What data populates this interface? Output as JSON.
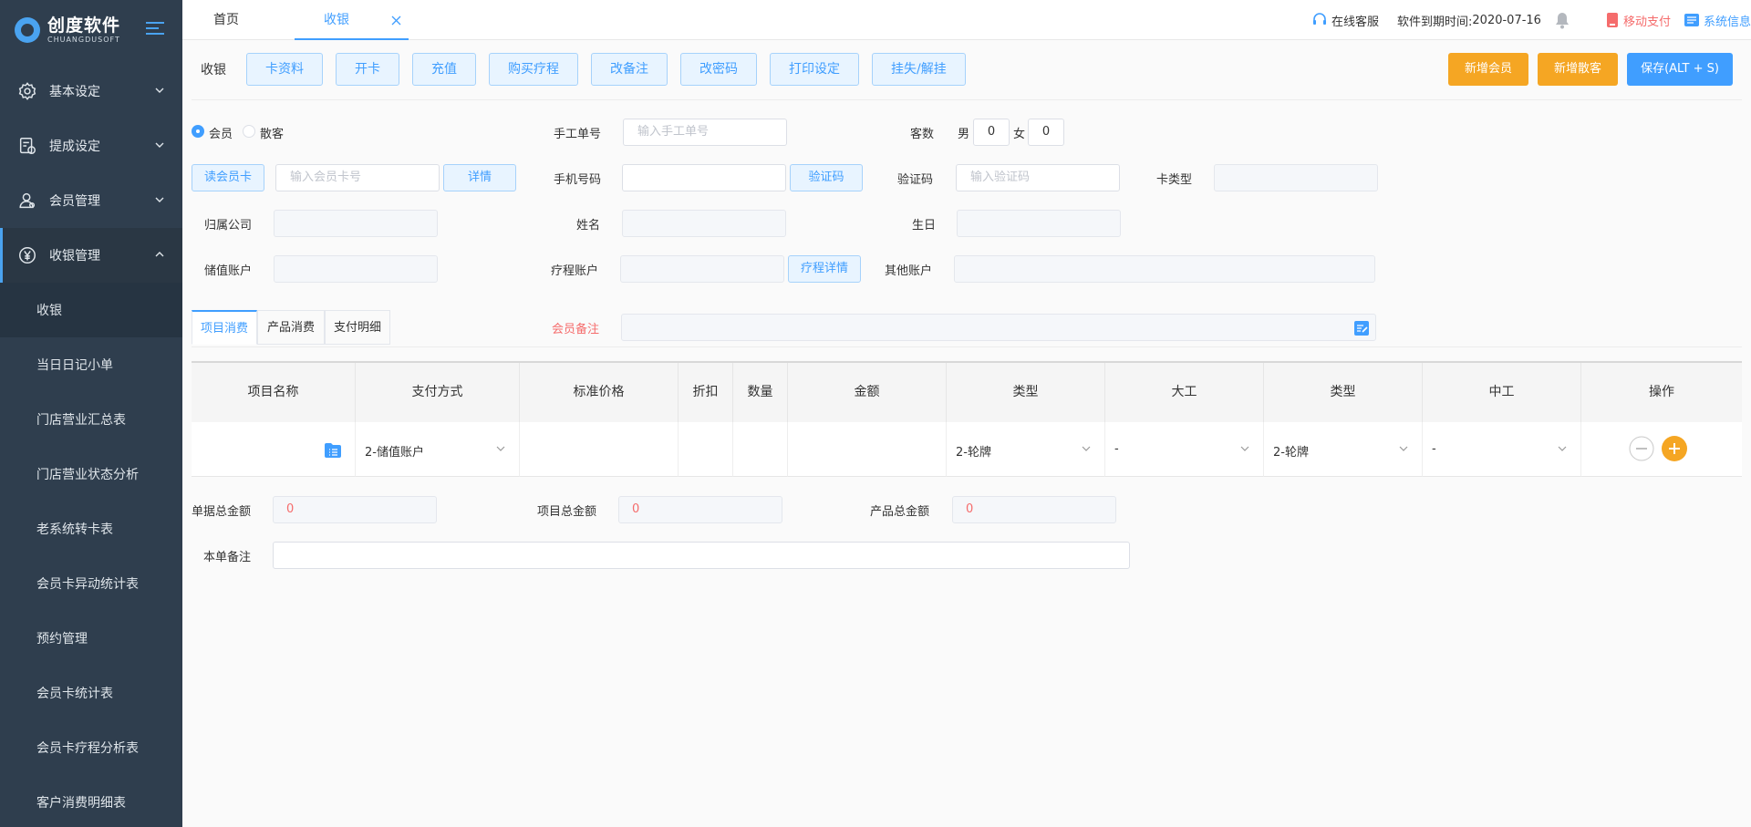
{
  "sidebar": {
    "logo_cn": "创度软件",
    "logo_en": "CHUANGDUSOFT",
    "groups": [
      {
        "label": "基本设定",
        "icon": "gear-icon"
      },
      {
        "label": "提成设定",
        "icon": "commission-icon"
      },
      {
        "label": "会员管理",
        "icon": "member-icon"
      },
      {
        "label": "收银管理",
        "icon": "yen-icon"
      }
    ],
    "sub_items": [
      "收银",
      "当日日记小单",
      "门店营业汇总表",
      "门店营业状态分析",
      "老系统转卡表",
      "会员卡异动统计表",
      "预约管理",
      "会员卡统计表",
      "会员卡疗程分析表",
      "客户消费明细表"
    ]
  },
  "topbar": {
    "tabs": [
      "首页",
      "收银"
    ],
    "online_service": "在线客服",
    "expire_label": "软件到期时间:",
    "expire_date": "2020-07-16",
    "mobile_pay": "移动支付",
    "system_info": "系统信息"
  },
  "toolbar": {
    "title": "收银",
    "buttons": [
      "卡资料",
      "开卡",
      "充值",
      "购买疗程",
      "改备注",
      "改密码",
      "打印设定",
      "挂失/解挂"
    ],
    "new_member": "新增会员",
    "new_guest": "新增散客",
    "save": "保存(ALT + S)"
  },
  "form": {
    "radio_member": "会员",
    "radio_guest": "散客",
    "manual_no_label": "手工单号",
    "manual_no_placeholder": "输入手工单号",
    "guest_count_label": "客数",
    "male_label": "男",
    "male_count": "0",
    "female_label": "女",
    "female_count": "0",
    "read_card": "读会员卡",
    "card_no_placeholder": "输入会员卡号",
    "detail": "详情",
    "phone_label": "手机号码",
    "verify_btn": "验证码",
    "verify_label": "验证码",
    "verify_placeholder": "输入验证码",
    "card_type_label": "卡类型",
    "company_label": "归属公司",
    "name_label": "姓名",
    "birthday_label": "生日",
    "stored_label": "储值账户",
    "course_label": "疗程账户",
    "course_detail": "疗程详情",
    "other_label": "其他账户",
    "remark_label": "会员备注"
  },
  "sub_tabs": [
    "项目消费",
    "产品消费",
    "支付明细"
  ],
  "table": {
    "headers": [
      "项目名称",
      "支付方式",
      "标准价格",
      "折扣",
      "数量",
      "金额",
      "类型",
      "大工",
      "类型",
      "中工",
      "操作"
    ],
    "row": {
      "payment": "2-储值账户",
      "type1": "2-轮牌",
      "worker1": "-",
      "type2": "2-轮牌",
      "worker2": "-"
    }
  },
  "totals": {
    "bill_label": "单据总金额",
    "bill_value": "0",
    "project_label": "项目总金额",
    "project_value": "0",
    "product_label": "产品总金额",
    "product_value": "0",
    "note_label": "本单备注"
  },
  "colors": {
    "sidebar_bg": "#2f3e4e",
    "accent": "#409eff",
    "orange": "#f5a623",
    "red": "#f56c6c"
  }
}
